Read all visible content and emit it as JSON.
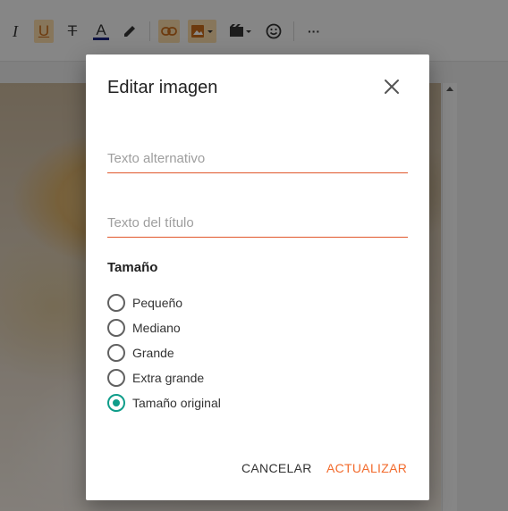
{
  "toolbar": {
    "icons": [
      "italic-icon",
      "underline-icon",
      "strikethrough-icon",
      "text-color-icon",
      "highlighter-icon",
      "link-icon",
      "image-icon",
      "video-icon",
      "emoji-icon",
      "more-icon"
    ],
    "italic_glyph": "I",
    "underline_glyph": "U",
    "strikethrough_glyph": "T",
    "textcolor_glyph": "A",
    "more_glyph": "···"
  },
  "dialog": {
    "title": "Editar imagen",
    "alt_text_placeholder": "Texto alternativo",
    "title_text_placeholder": "Texto del título",
    "size_heading": "Tamaño",
    "size_options": [
      {
        "label": "Pequeño",
        "selected": false
      },
      {
        "label": "Mediano",
        "selected": false
      },
      {
        "label": "Grande",
        "selected": false
      },
      {
        "label": "Extra grande",
        "selected": false
      },
      {
        "label": "Tamaño original",
        "selected": true
      }
    ],
    "cancel_label": "CANCELAR",
    "update_label": "ACTUALIZAR"
  },
  "colors": {
    "accent": "#f26b2d",
    "field_underline": "#e0572b",
    "radio_selected": "#0f9d8a",
    "text_color_bar": "#1a237e"
  }
}
